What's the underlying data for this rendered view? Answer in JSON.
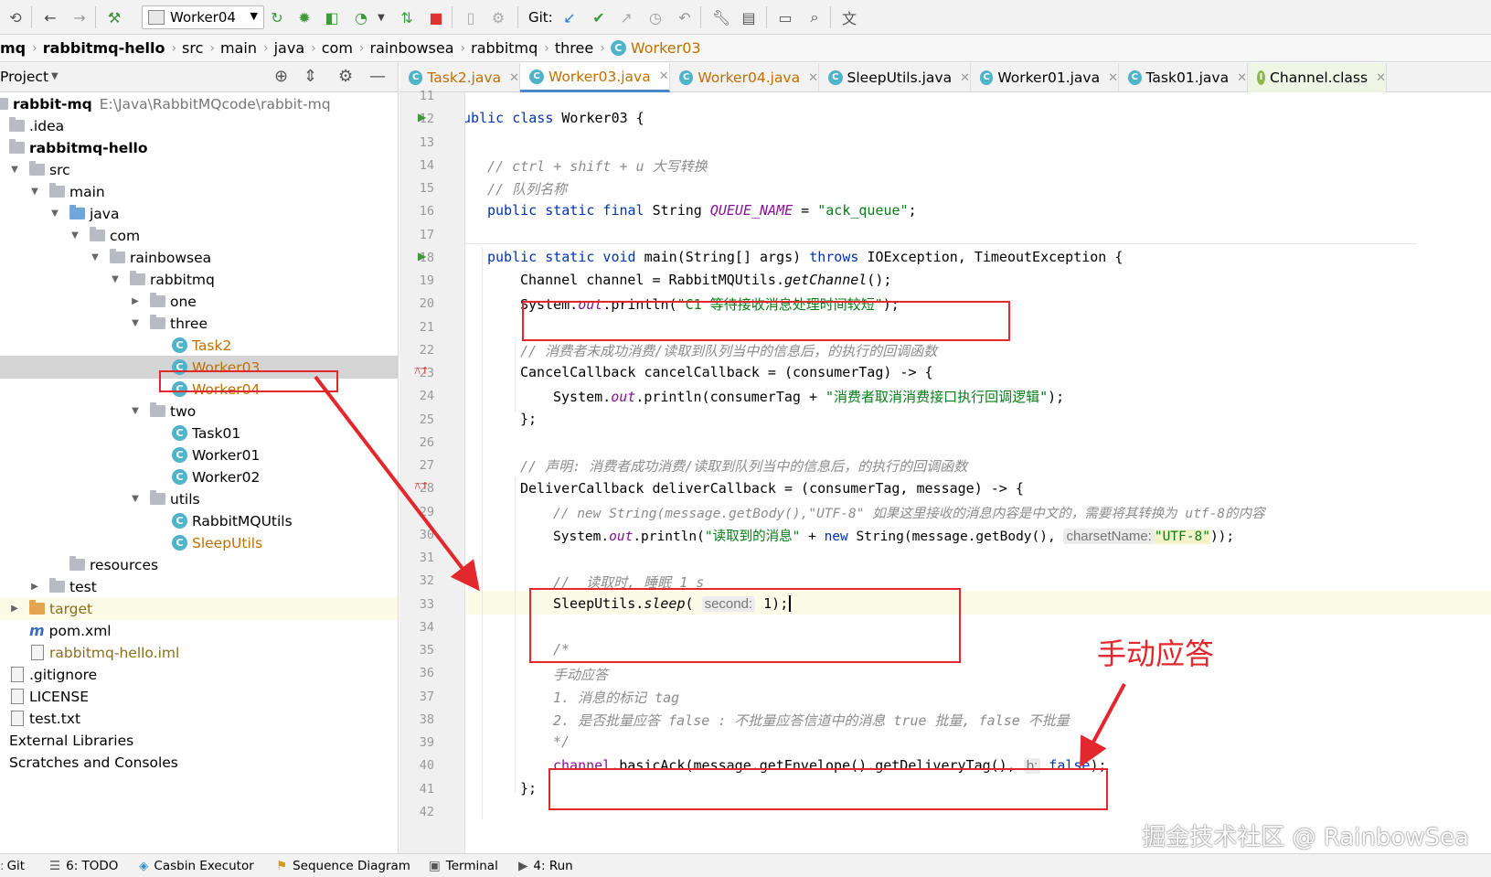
{
  "toolbar": {
    "run_config": "Worker04",
    "git_label": "Git:"
  },
  "breadcrumb": [
    "mq",
    "rabbitmq-hello",
    "src",
    "main",
    "java",
    "com",
    "rainbowsea",
    "rabbitmq",
    "three",
    "Worker03"
  ],
  "project_panel": {
    "title": "Project",
    "tree": [
      {
        "label": "rabbit-mq",
        "path": "E:\\Java\\RabbitMQcode\\rabbit-mq"
      },
      {
        "label": ".idea"
      },
      {
        "label": "rabbitmq-hello"
      },
      {
        "label": "src"
      },
      {
        "label": "main"
      },
      {
        "label": "java"
      },
      {
        "label": "com"
      },
      {
        "label": "rainbowsea"
      },
      {
        "label": "rabbitmq"
      },
      {
        "label": "one"
      },
      {
        "label": "three"
      },
      {
        "label": "Task2"
      },
      {
        "label": "Worker03"
      },
      {
        "label": "Worker04"
      },
      {
        "label": "two"
      },
      {
        "label": "Task01"
      },
      {
        "label": "Worker01"
      },
      {
        "label": "Worker02"
      },
      {
        "label": "utils"
      },
      {
        "label": "RabbitMQUtils"
      },
      {
        "label": "SleepUtils"
      },
      {
        "label": "resources"
      },
      {
        "label": "test"
      },
      {
        "label": "target"
      },
      {
        "label": "pom.xml"
      },
      {
        "label": "rabbitmq-hello.iml"
      },
      {
        "label": ".gitignore"
      },
      {
        "label": "LICENSE"
      },
      {
        "label": "test.txt"
      },
      {
        "label": "External Libraries"
      },
      {
        "label": "Scratches and Consoles"
      }
    ]
  },
  "tabs": [
    {
      "label": "Task2.java"
    },
    {
      "label": "Worker03.java"
    },
    {
      "label": "Worker04.java"
    },
    {
      "label": "SleepUtils.java"
    },
    {
      "label": "Worker01.java"
    },
    {
      "label": "Task01.java"
    },
    {
      "label": "Channel.class"
    }
  ],
  "gutter": {
    "line_numbers": [
      "11",
      "12",
      "13",
      "14",
      "15",
      "16",
      "17",
      "18",
      "19",
      "20",
      "21",
      "22",
      "23",
      "24",
      "25",
      "26",
      "27",
      "28",
      "29",
      "30",
      "31",
      "32",
      "33",
      "34",
      "35",
      "36",
      "37",
      "38",
      "39",
      "40",
      "41",
      "42"
    ]
  },
  "code": {
    "l12_a": "public class ",
    "l12_b": "Worker03 {",
    "l14": "// ctrl + shift + u 大写转换",
    "l15": "// 队列名称",
    "l16_a": "public static final ",
    "l16_b": "String ",
    "l16_c": "QUEUE_NAME",
    "l16_d": " = ",
    "l16_e": "\"ack_queue\"",
    "l16_f": ";",
    "l18_a": "public static void ",
    "l18_b": "main(String[] args) ",
    "l18_c": "throws ",
    "l18_d": "IOException, TimeoutException {",
    "l19_a": "Channel channel = RabbitMQUtils.",
    "l19_b": "getChannel",
    "l19_c": "();",
    "l20_a": "System.",
    "l20_b": "out",
    "l20_c": ".println(",
    "l20_d": "\"C1 等待接收消息处理时间较短\"",
    "l20_e": ");",
    "l22": "// 消费者未成功消费/读取到队列当中的信息后，的执行的回调函数",
    "l23": "CancelCallback cancelCallback = (consumerTag) -> {",
    "l24_a": "System.",
    "l24_b": "out",
    "l24_c": ".println(consumerTag + ",
    "l24_d": "\"消费者取消消费接口执行回调逻辑\"",
    "l24_e": ");",
    "l25": "};",
    "l27": "// 声明: 消费者成功消费/读取到队列当中的信息后，的执行的回调函数",
    "l28": "DeliverCallback deliverCallback = (consumerTag, message) -> {",
    "l29": "// new String(message.getBody(),\"UTF-8\" 如果这里接收的消息内容是中文的，需要将其转换为 utf-8的内容",
    "l30_a": "System.",
    "l30_b": "out",
    "l30_c": ".println(",
    "l30_d": "\"读取到的消息\"",
    "l30_e": " + ",
    "l30_f": "new ",
    "l30_g": "String(message.getBody(), ",
    "l30_h": "charsetName:",
    "l30_i": "\"UTF-8\"",
    "l30_j": "));",
    "l32": "//  读取时, 睡眠 1 s",
    "l33_a": "SleepUtils.",
    "l33_b": "sleep",
    "l33_c": "( ",
    "l33_d": "second:",
    "l33_e": " 1);",
    "l35": "/*",
    "l36": "手动应答",
    "l37": "1. 消息的标记 tag",
    "l38": "2. 是否批量应答 false : 不批量应答信道中的消息 true 批量, false 不批量",
    "l39": "*/",
    "l40_a": "channel",
    "l40_b": ".basicAck(message.getEnvelope().getDeliveryTag(), ",
    "l40_c": "b:",
    "l40_d": " false",
    "l40_e": ");",
    "l41": "};"
  },
  "annotation": {
    "label": "手动应答",
    "color": "#e2272d"
  },
  "bottom_bar": [
    {
      "label": "Git"
    },
    {
      "label": "6: TODO"
    },
    {
      "label": "Casbin Executor"
    },
    {
      "label": "Sequence Diagram"
    },
    {
      "label": "Terminal"
    },
    {
      "label": "4: Run"
    }
  ],
  "watermark": "掘金技术社区 @ RainbowSea"
}
